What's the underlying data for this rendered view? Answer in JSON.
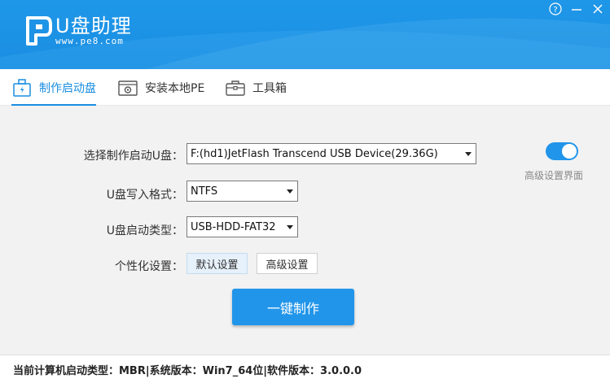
{
  "app": {
    "title": "U盘助理",
    "url": "www.pe8.com"
  },
  "window_controls": {
    "help": "?",
    "minimize": "—",
    "close": "✕"
  },
  "tabs": [
    {
      "label": "制作启动盘",
      "active": true,
      "icon": "usb-drive-icon"
    },
    {
      "label": "安装本地PE",
      "active": false,
      "icon": "gear-install-icon"
    },
    {
      "label": "工具箱",
      "active": false,
      "icon": "toolbox-icon"
    }
  ],
  "form": {
    "device_label": "选择制作启动U盘：",
    "device_value": "F:(hd1)JetFlash Transcend USB Device(29.36G)",
    "format_label": "U盘写入格式：",
    "format_value": "NTFS",
    "boot_type_label": "U盘启动类型：",
    "boot_type_value": "USB-HDD-FAT32",
    "personal_label": "个性化设置：",
    "default_settings": "默认设置",
    "advanced_settings": "高级设置"
  },
  "toggle": {
    "label": "高级设置界面",
    "on": true
  },
  "make_button": "一键制作",
  "footer": {
    "status": "当前计算机启动类型：MBR|系统版本：Win7_64位|软件版本：3.0.0.0"
  },
  "colors": {
    "header": "#1a8ee2",
    "accent": "#2195ea",
    "content_bg": "#f2f2f2"
  }
}
